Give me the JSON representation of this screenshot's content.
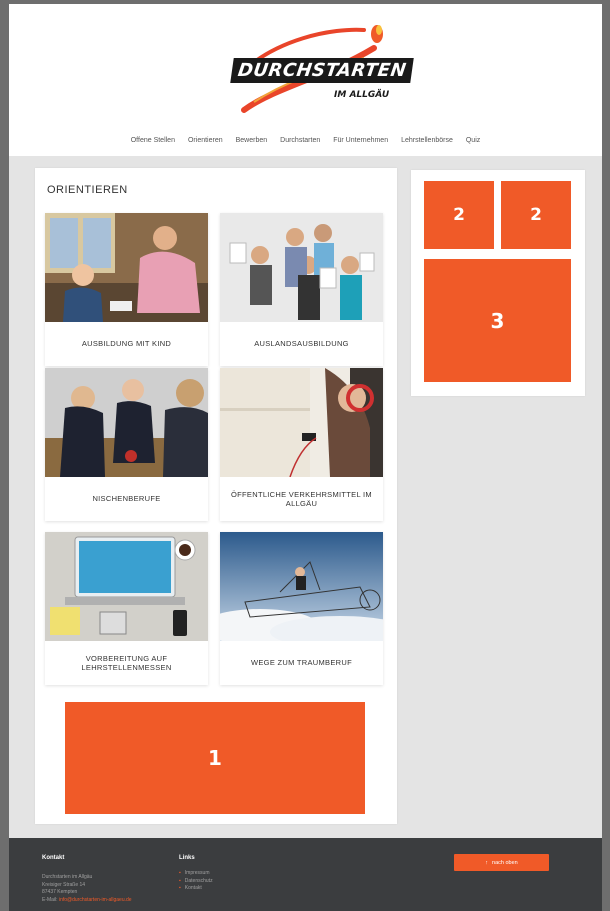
{
  "header": {
    "logo_line1": "DURCHSTARTEN",
    "logo_line2": "IM ALLGÄU",
    "nav": [
      "Offene Stellen",
      "Orientieren",
      "Bewerben",
      "Durchstarten",
      "Für Unternehmen",
      "Lehrstellenbörse",
      "Quiz"
    ]
  },
  "main": {
    "title": "ORIENTIEREN",
    "tiles": [
      {
        "caption": "AUSBILDUNG MIT KIND"
      },
      {
        "caption": "AUSLANDSAUSBILDUNG"
      },
      {
        "caption": "NISCHENBERUFE"
      },
      {
        "caption": "ÖFFENTLICHE VERKEHRSMITTEL IM ALLGÄU"
      },
      {
        "caption": "VORBEREITUNG AUF LEHRSTELLENMESSEN"
      },
      {
        "caption": "WEGE ZUM TRAUMBERUF"
      }
    ],
    "ad_label": "1"
  },
  "sidebar": {
    "ad_small_1": "2",
    "ad_small_2": "2",
    "ad_large": "3"
  },
  "footer": {
    "kontakt_title": "Kontakt",
    "kontakt_lines": [
      "Durchstarten im Allgäu",
      "Kreisiger Straße 14",
      "87437 Kempten"
    ],
    "email_label": "E-Mail:",
    "email": "info@durchstarten-im-allgaeu.de",
    "links_title": "Links",
    "links": [
      "Impressum",
      "Datenschutz",
      "Kontakt"
    ],
    "back_to_top": "nach oben",
    "back_to_top_icon": "arrow-up-icon"
  },
  "colors": {
    "accent": "#f05a28",
    "footer_bg": "#3b3d3f",
    "page_bg": "#e4e4e4"
  }
}
